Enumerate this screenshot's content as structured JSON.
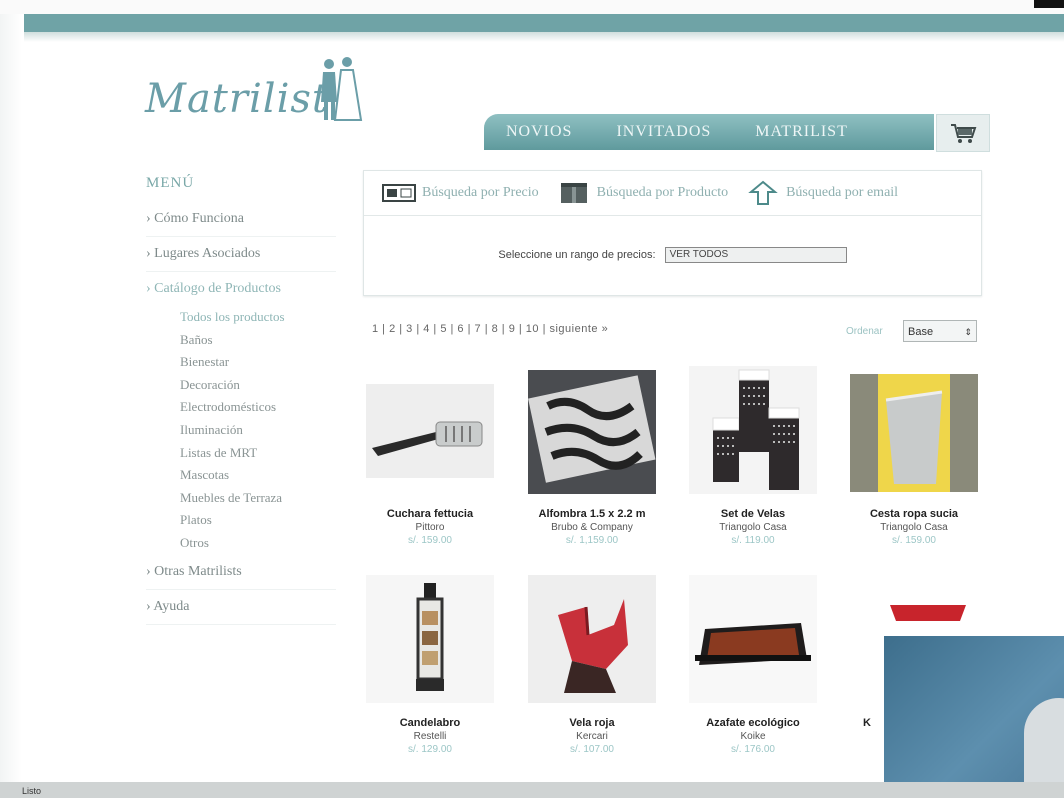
{
  "logo": {
    "text": "Matrilist"
  },
  "tabs": [
    "NOVIOS",
    "INVITADOS",
    "MATRILIST"
  ],
  "sidebar": {
    "title": "MENÚ",
    "items": [
      {
        "label": "› Cómo Funciona"
      },
      {
        "label": "› Lugares Asociados"
      },
      {
        "label": "› Catálogo de Productos"
      }
    ],
    "subitems": [
      "Todos los productos",
      "Baños",
      "Bienestar",
      "Decoración",
      "Electrodomésticos",
      "Iluminación",
      "Listas de MRT",
      "Mascotas",
      "Muebles de Terraza",
      "Platos",
      "Otros"
    ],
    "after_items": [
      {
        "label": "› Otras Matrilists"
      },
      {
        "label": "› Ayuda"
      }
    ]
  },
  "search": {
    "tabs": [
      "Búsqueda por Precio",
      "Búsqueda por Producto",
      "Búsqueda por email"
    ],
    "price_label": "Seleccione un rango de precios:",
    "price_value": "VER TODOS"
  },
  "pagination": {
    "text": "1 | 2 | 3 | 4 | 5 | 6 | 7 | 8 | 9 | 10 | siguiente »"
  },
  "order": {
    "label": "Ordenar",
    "value": "Base"
  },
  "products": [
    {
      "name": "Cuchara fettucia",
      "brand": "Pittoro",
      "price": "s/. 159.00"
    },
    {
      "name": "Alfombra 1.5 x 2.2 m",
      "brand": "Brubo & Company",
      "price": "s/. 1,159.00"
    },
    {
      "name": "Set de Velas",
      "brand": "Triangolo Casa",
      "price": "s/. 119.00"
    },
    {
      "name": "Cesta ropa sucia",
      "brand": "Triangolo Casa",
      "price": "s/. 159.00"
    },
    {
      "name": "Candelabro",
      "brand": "Restelli",
      "price": "s/. 129.00"
    },
    {
      "name": "Vela roja",
      "brand": "Kercari",
      "price": "s/. 107.00"
    },
    {
      "name": "Azafate ecológico",
      "brand": "Koike",
      "price": "s/. 176.00"
    },
    {
      "name": "K",
      "brand": "",
      "price": ""
    }
  ],
  "status_bar": {
    "text": "Listo"
  },
  "colors": {
    "accent": "#6fa3a6",
    "link": "#9cc6c6"
  }
}
